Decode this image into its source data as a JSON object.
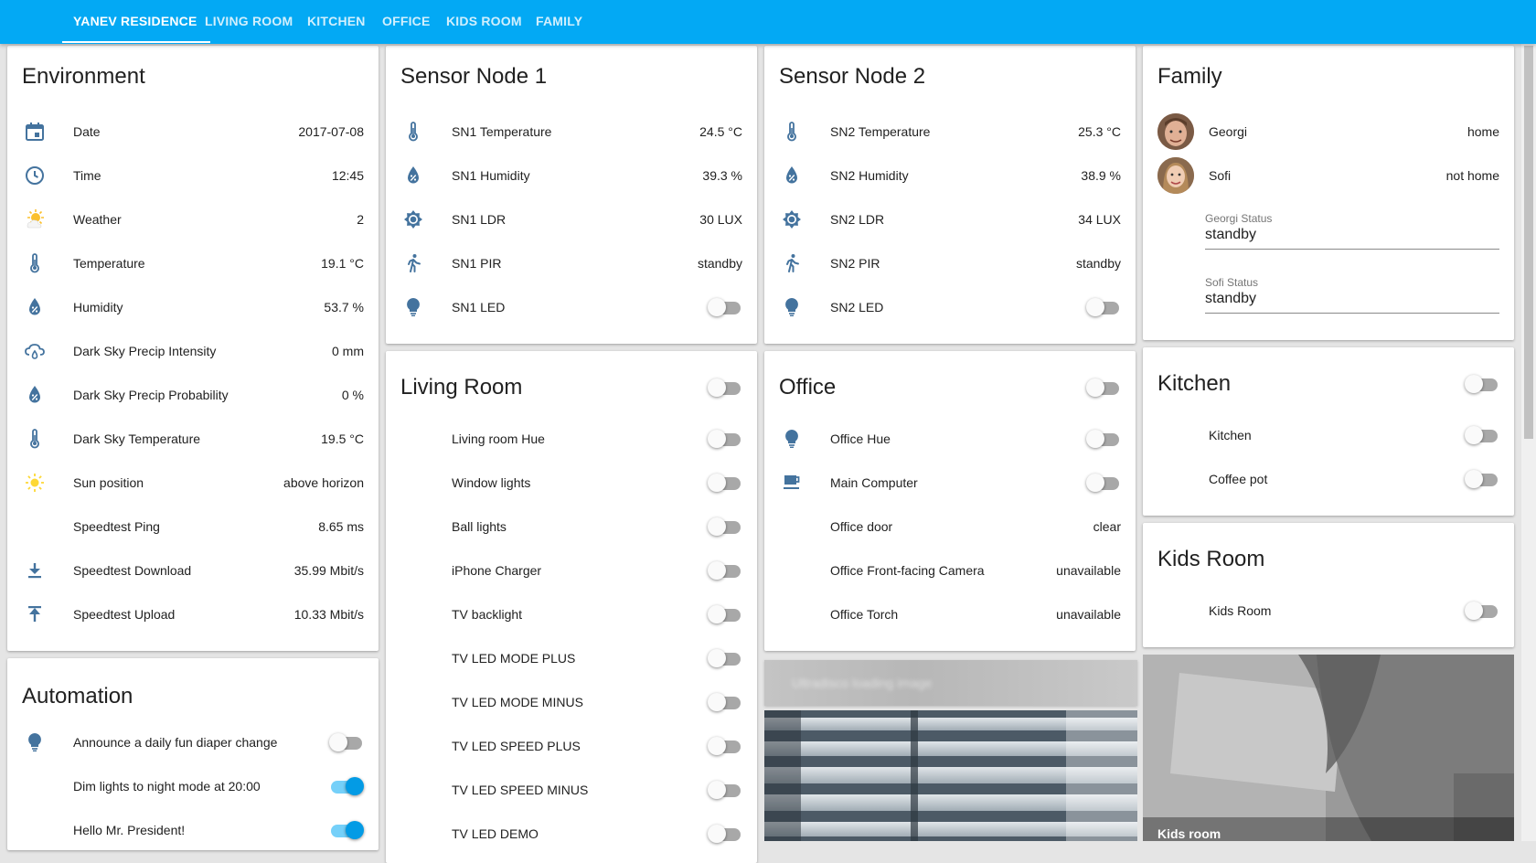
{
  "tabs": [
    {
      "label": "YANEV RESIDENCE",
      "active": true
    },
    {
      "label": "LIVING ROOM"
    },
    {
      "label": "KITCHEN"
    },
    {
      "label": "OFFICE"
    },
    {
      "label": "KIDS ROOM"
    },
    {
      "label": "FAMILY"
    }
  ],
  "colors": {
    "accent": "#03a9f4",
    "icon": "#44739e",
    "sun": "#fdd835"
  },
  "environment": {
    "title": "Environment",
    "rows": [
      {
        "icon": "calendar-icon",
        "label": "Date",
        "value": "2017-07-08"
      },
      {
        "icon": "clock-icon",
        "label": "Time",
        "value": "12:45"
      },
      {
        "icon": "weather-partly-sunny-icon",
        "label": "Weather",
        "value": "2"
      },
      {
        "icon": "thermometer-icon",
        "label": "Temperature",
        "value": "19.1 °C"
      },
      {
        "icon": "water-percent-icon",
        "label": "Humidity",
        "value": "53.7 %"
      },
      {
        "icon": "cloud-rain-icon",
        "label": "Dark Sky Precip Intensity",
        "value": "0 mm"
      },
      {
        "icon": "water-percent-icon",
        "label": "Dark Sky Precip Probability",
        "value": "0 %"
      },
      {
        "icon": "thermometer-icon",
        "label": "Dark Sky Temperature",
        "value": "19.5 °C"
      },
      {
        "icon": "sun-icon",
        "label": "Sun position",
        "value": "above horizon"
      },
      {
        "icon": "",
        "label": "Speedtest Ping",
        "value": "8.65 ms"
      },
      {
        "icon": "download-icon",
        "label": "Speedtest Download",
        "value": "35.99 Mbit/s"
      },
      {
        "icon": "upload-icon",
        "label": "Speedtest Upload",
        "value": "10.33 Mbit/s"
      }
    ]
  },
  "automation": {
    "title": "Automation",
    "rows": [
      {
        "icon": "lightbulb-icon",
        "label": "Announce a daily fun diaper change",
        "on": false
      },
      {
        "icon": "",
        "label": "Dim lights to night mode at 20:00",
        "on": true
      },
      {
        "icon": "",
        "label": "Hello Mr. President!",
        "on": true
      }
    ]
  },
  "sensor1": {
    "title": "Sensor Node 1",
    "rows": [
      {
        "icon": "thermometer-icon",
        "label": "SN1 Temperature",
        "value": "24.5 °C"
      },
      {
        "icon": "water-percent-icon",
        "label": "SN1 Humidity",
        "value": "39.3 %"
      },
      {
        "icon": "brightness-icon",
        "label": "SN1 LDR",
        "value": "30 LUX"
      },
      {
        "icon": "walk-icon",
        "label": "SN1 PIR",
        "value": "standby"
      },
      {
        "icon": "lightbulb-icon",
        "label": "SN1 LED",
        "on": false
      }
    ]
  },
  "sensor2": {
    "title": "Sensor Node 2",
    "rows": [
      {
        "icon": "thermometer-icon",
        "label": "SN2 Temperature",
        "value": "25.3 °C"
      },
      {
        "icon": "water-percent-icon",
        "label": "SN2 Humidity",
        "value": "38.9 %"
      },
      {
        "icon": "brightness-icon",
        "label": "SN2 LDR",
        "value": "34 LUX"
      },
      {
        "icon": "walk-icon",
        "label": "SN2 PIR",
        "value": "standby"
      },
      {
        "icon": "lightbulb-icon",
        "label": "SN2 LED",
        "on": false
      }
    ]
  },
  "living_room": {
    "title": "Living Room",
    "header_on": false,
    "rows": [
      {
        "label": "Living room Hue",
        "on": false
      },
      {
        "label": "Window lights",
        "on": false
      },
      {
        "label": "Ball lights",
        "on": false
      },
      {
        "label": "iPhone Charger",
        "on": false
      },
      {
        "label": "TV backlight",
        "on": false
      },
      {
        "label": "TV LED MODE PLUS",
        "on": false
      },
      {
        "label": "TV LED MODE MINUS",
        "on": false
      },
      {
        "label": "TV LED SPEED PLUS",
        "on": false
      },
      {
        "label": "TV LED SPEED MINUS",
        "on": false
      },
      {
        "label": "TV LED DEMO",
        "on": false
      }
    ]
  },
  "office": {
    "title": "Office",
    "header_on": false,
    "rows": [
      {
        "icon": "lightbulb-icon",
        "label": "Office Hue",
        "on": false
      },
      {
        "icon": "coffee-icon",
        "label": "Main Computer",
        "on": false
      },
      {
        "icon": "",
        "label": "Office door",
        "value": "clear"
      },
      {
        "icon": "",
        "label": "Office Front-facing Camera",
        "value": "unavailable"
      },
      {
        "icon": "",
        "label": "Office Torch",
        "value": "unavailable"
      }
    ]
  },
  "family": {
    "title": "Family",
    "members": [
      {
        "name": "Georgi",
        "state": "home"
      },
      {
        "name": "Sofi",
        "state": "not home"
      }
    ],
    "inputs": [
      {
        "label": "Georgi Status",
        "value": "standby"
      },
      {
        "label": "Sofi Status",
        "value": "standby"
      }
    ]
  },
  "kitchen": {
    "title": "Kitchen",
    "header_on": false,
    "rows": [
      {
        "label": "Kitchen",
        "on": false
      },
      {
        "label": "Coffee pot",
        "on": false
      }
    ]
  },
  "kids_room": {
    "title": "Kids Room",
    "rows": [
      {
        "label": "Kids Room",
        "on": false
      }
    ]
  },
  "cameras": {
    "office_loading_text": "Ultradisco loading image",
    "kids_caption": "Kids room"
  }
}
